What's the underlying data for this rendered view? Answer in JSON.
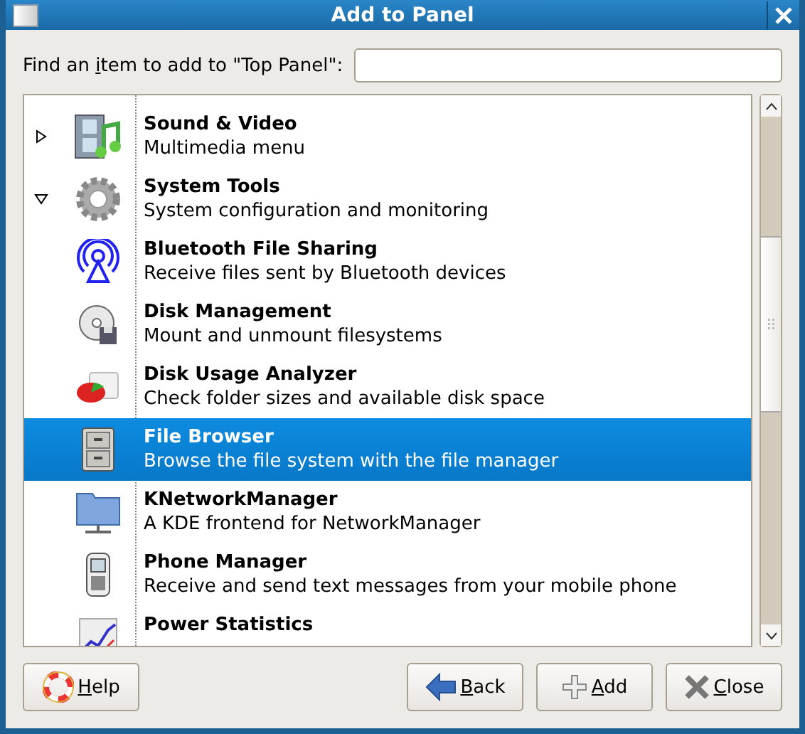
{
  "window": {
    "title": "Add to Panel"
  },
  "search": {
    "label": {
      "before": "Find an ",
      "key": "i",
      "after": "tem to add to \"Top Panel\":"
    }
  },
  "tree": [
    {
      "kind": "media",
      "name": "Sound & Video",
      "description": "Multimedia menu",
      "expanded": false,
      "selected": false
    },
    {
      "kind": "gear",
      "name": "System Tools",
      "description": "System configuration and monitoring",
      "expanded": true,
      "selected": false,
      "children": [
        {
          "kind": "bluetooth",
          "name": "Bluetooth File Sharing",
          "description": "Receive files sent by Bluetooth devices",
          "selected": false
        },
        {
          "kind": "disk",
          "name": "Disk Management",
          "description": "Mount and unmount filesystems",
          "selected": false
        },
        {
          "kind": "pie",
          "name": "Disk Usage Analyzer",
          "description": "Check folder sizes and available disk space",
          "selected": false
        },
        {
          "kind": "cabinet",
          "name": "File Browser",
          "description": "Browse the file system with the file manager",
          "selected": true
        },
        {
          "kind": "network",
          "name": "KNetworkManager",
          "description": "A KDE frontend for NetworkManager",
          "selected": false
        },
        {
          "kind": "phone",
          "name": "Phone Manager",
          "description": "Receive and send text messages from your mobile phone",
          "selected": false
        },
        {
          "kind": "chart",
          "name": "Power Statistics",
          "selected": false
        }
      ]
    }
  ],
  "buttons": [
    {
      "kind": "help",
      "key": "H",
      "after": "elp"
    },
    {
      "kind": "back",
      "key": "B",
      "after": "ack"
    },
    {
      "kind": "add",
      "key": "A",
      "after": "dd"
    },
    {
      "kind": "close",
      "key": "C",
      "after": "lose"
    }
  ]
}
